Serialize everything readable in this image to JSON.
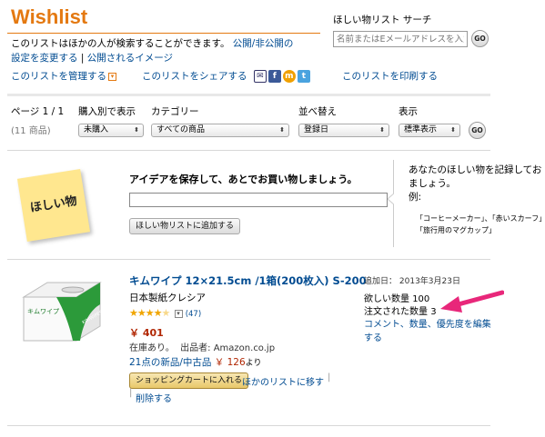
{
  "header": {
    "title": "Wishlist",
    "desc_text": "このリストはほかの人が検索することができます。",
    "desc_link_1": "公開/非公開の",
    "desc_link_2": "設定を変更する",
    "desc_link_3": "公開されるイメージ"
  },
  "search": {
    "label": "ほしい物リスト サーチ",
    "placeholder": "名前またはEメールアドレスを入力",
    "go_label": "GO"
  },
  "actions": {
    "manage": "このリストを管理する",
    "share": "このリストをシェアする",
    "print": "このリストを印刷する",
    "share_icons": [
      "mail-icon",
      "facebook-icon",
      "mixi-icon",
      "twitter-icon"
    ]
  },
  "toolbar": {
    "page_label": "ページ 1 / 1",
    "count_label": "(11 商品)",
    "view_label": "購入別で表示",
    "view_value": "未購入",
    "category_label": "カテゴリー",
    "category_value": "すべての商品",
    "sort_label": "並べ替え",
    "sort_value": "登録日",
    "display_label": "表示",
    "display_value": "標準表示",
    "go_label": "GO"
  },
  "idea": {
    "sticky_text": "ほしい物",
    "heading": "アイデアを保存して、あとでお買い物しましょう。",
    "input_value": "",
    "add_button": "ほしい物リストに追加する",
    "hint_line1": "あなたのほしい物を記録してお",
    "hint_line2": "ましょう。",
    "hint_example_label": "例:",
    "hint_example1": "「コーヒーメーカー」、「赤いスカーフ」",
    "hint_example2": "「旅行用のマグカップ」"
  },
  "item": {
    "title": "キムワイプ 12×21.5cm /1箱(200枚入) S-200",
    "brand": "日本製紙クレシア",
    "rating_stars": 4.5,
    "rating_count": "(47)",
    "price": "￥ 401",
    "stock": "在庫あり。",
    "seller": "出品者: Amazon.co.jp",
    "offers_link": "21点の新品/中古品",
    "offers_price": "￥ 126",
    "offers_suffix": "より",
    "add_to_cart": "ショッピングカートに入れる",
    "move_link": "ほかのリストに移す",
    "delete_link": "削除する",
    "added_label": "追加日：",
    "added_date": "2013年3月23日",
    "desired_label": "欲しい数量",
    "desired_value": "100",
    "ordered_label": "注文された数量",
    "ordered_value": "3",
    "edit_link_1": "コメント、数量、優先度を編集",
    "edit_link_2": "する",
    "package_brand": "キムワイプ",
    "package_sub": "KIMWIPES"
  },
  "colors": {
    "title_orange": "#e47911",
    "link_blue": "#004b91",
    "price_red": "#b12704",
    "arrow_pink": "#e8277a",
    "sticky_yellow": "#ffe78f"
  }
}
